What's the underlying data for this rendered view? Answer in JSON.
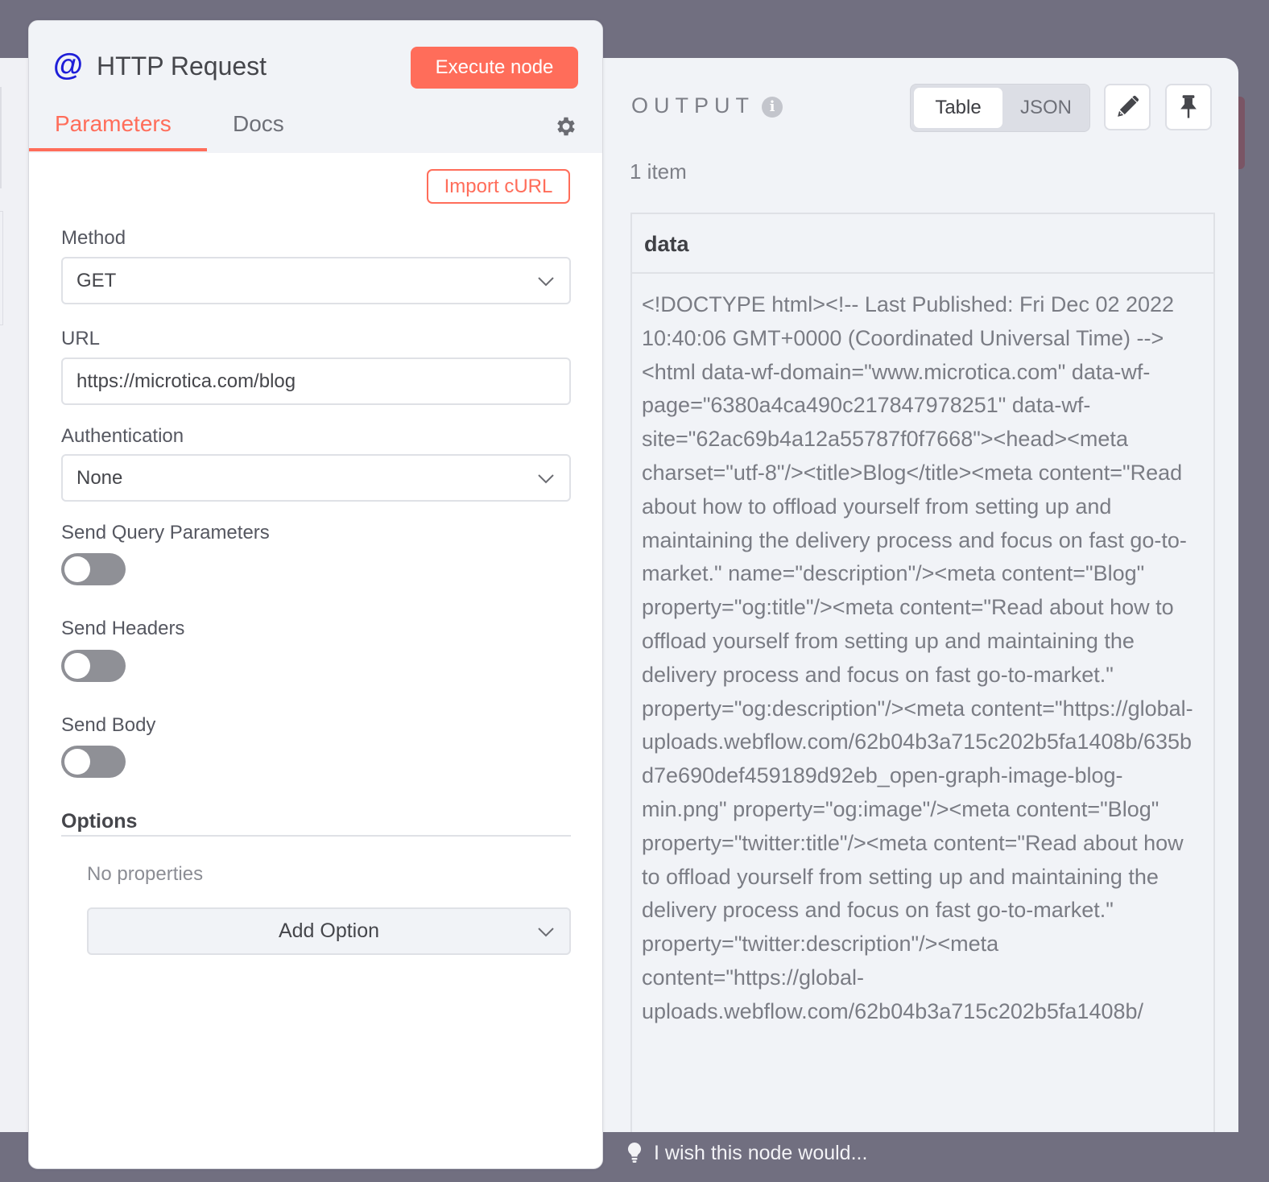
{
  "node": {
    "icon": "@",
    "title": "HTTP Request",
    "execute_label": "Execute node",
    "tabs": [
      {
        "label": "Parameters",
        "active": true
      },
      {
        "label": "Docs",
        "active": false
      }
    ],
    "import_curl_label": "Import cURL"
  },
  "parameters": {
    "method": {
      "label": "Method",
      "value": "GET"
    },
    "url": {
      "label": "URL",
      "value": "https://microtica.com/blog"
    },
    "authentication": {
      "label": "Authentication",
      "value": "None"
    },
    "send_query": {
      "label": "Send Query Parameters",
      "enabled": false
    },
    "send_headers": {
      "label": "Send Headers",
      "enabled": false
    },
    "send_body": {
      "label": "Send Body",
      "enabled": false
    },
    "options": {
      "title": "Options",
      "empty_text": "No properties",
      "add_label": "Add Option"
    }
  },
  "output": {
    "title": "OUTPUT",
    "view_modes": [
      {
        "label": "Table",
        "active": true
      },
      {
        "label": "JSON",
        "active": false
      }
    ],
    "items_count": "1 item",
    "table": {
      "columns": [
        "data"
      ],
      "rows": [
        [
          "<!DOCTYPE html><!-- Last Published: Fri Dec 02 2022 10:40:06 GMT+0000 (Coordinated Universal Time) --><html data-wf-domain=\"www.microtica.com\" data-wf-page=\"6380a4ca490c217847978251\" data-wf-site=\"62ac69b4a12a55787f0f7668\"><head><meta charset=\"utf-8\"/><title>Blog</title><meta content=\"Read about how to offload yourself from setting up and maintaining the delivery process and focus on fast go-to-market.\" name=\"description\"/><meta content=\"Blog\" property=\"og:title\"/><meta content=\"Read about how to offload yourself from setting up and maintaining the delivery process and focus on fast go-to-market.\" property=\"og:description\"/><meta content=\"https://global-uploads.webflow.com/62b04b3a715c202b5fa1408b/635bd7e690def459189d92eb_open-graph-image-blog-min.png\" property=\"og:image\"/><meta content=\"Blog\" property=\"twitter:title\"/><meta content=\"Read about how to offload yourself from setting up and maintaining the delivery process and focus on fast go-to-market.\" property=\"twitter:description\"/><meta content=\"https://global-uploads.webflow.com/62b04b3a715c202b5fa1408b/"
        ]
      ]
    }
  },
  "feedback": {
    "text": "I wish this node would..."
  },
  "colors": {
    "accent": "#ff6d5a",
    "node_icon": "#1e1ed8",
    "backdrop": "#716f80",
    "panel_bg": "#f1f3f7"
  }
}
